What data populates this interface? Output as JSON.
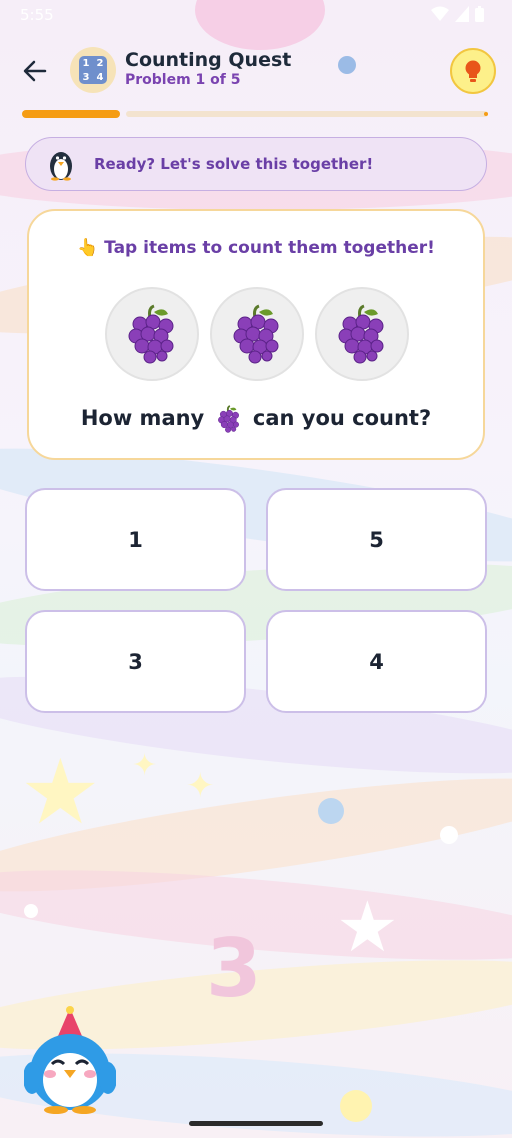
{
  "status_bar": {
    "time": "5:55"
  },
  "header": {
    "title": "Counting Quest",
    "subtitle": "Problem 1 of 5",
    "quest_icon_text": [
      "1",
      "2",
      "3",
      "4"
    ]
  },
  "progress": {
    "current": 1,
    "total": 5,
    "fraction": 0.2
  },
  "banner": {
    "text": "Ready? Let's solve this together!"
  },
  "card": {
    "instruction": "👆 Tap items to count them together!",
    "items": [
      "grapes-icon",
      "grapes-icon",
      "grapes-icon"
    ],
    "question_before": "How many",
    "question_after": "can you count?"
  },
  "answers": [
    {
      "label": "1"
    },
    {
      "label": "5"
    },
    {
      "label": "3"
    },
    {
      "label": "4"
    }
  ],
  "colors": {
    "accent_purple": "#6a3fa6",
    "progress_orange": "#f59c14",
    "hint_yellow": "#fdf08a",
    "hint_icon": "#e8551a"
  }
}
